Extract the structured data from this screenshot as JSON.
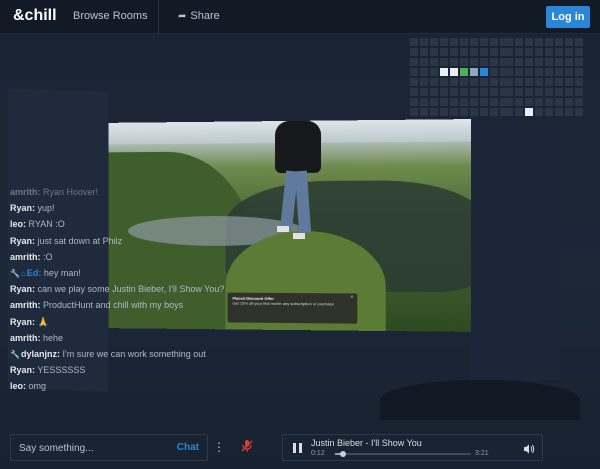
{
  "header": {
    "logo": "&chill",
    "browse_rooms": "Browse Rooms",
    "share": "Share",
    "login": "Log in"
  },
  "led_grid": {
    "grid_a_lit": [
      {
        "row": 3,
        "col": 3,
        "color": "#e8eef3"
      },
      {
        "row": 3,
        "col": 4,
        "color": "#e8eef3"
      },
      {
        "row": 3,
        "col": 5,
        "color": "#4caf50"
      },
      {
        "row": 3,
        "col": 6,
        "color": "#8fa7c2"
      },
      {
        "row": 3,
        "col": 7,
        "color": "#2a86d6"
      }
    ],
    "grid_b_lit": [
      {
        "row": 7,
        "col": 2,
        "color": "#e8eef3"
      }
    ]
  },
  "video": {
    "ad_title": "Placed Discount Offer",
    "ad_text": "Get 15% off your first month any subscription or purchase",
    "ad_close": "×"
  },
  "chat": {
    "messages": [
      {
        "user": "amrith:",
        "text": "Ryan Hoover!",
        "ghost": true
      },
      {
        "user": "Ryan:",
        "text": "yup!"
      },
      {
        "user": "leo:",
        "text": "RYAN :O"
      },
      {
        "user": "Ryan:",
        "text": "just sat down at Philz"
      },
      {
        "user": "amrith:",
        "text": ":O"
      },
      {
        "user": "Ed:",
        "text": "hey man!",
        "mod": true,
        "blue": true
      },
      {
        "user": "Ryan:",
        "text": "can we play some Justin Bieber, I'll Show You?"
      },
      {
        "user": "amrith:",
        "text": "ProductHunt and chill with my boys"
      },
      {
        "user": "Ryan:",
        "text": "🙏"
      },
      {
        "user": "amrith:",
        "text": "hehe"
      },
      {
        "user": "dylanjnz:",
        "text": "I'm sure we can work something out",
        "mod": true
      },
      {
        "user": "Ryan:",
        "text": "YESSSSSS"
      },
      {
        "user": "leo:",
        "text": "omg"
      }
    ],
    "input_placeholder": "Say something...",
    "send_label": "Chat",
    "more_label": "⋮"
  },
  "player": {
    "track": "Justin Bieber - I'll Show You",
    "current_time": "0:12",
    "total_time": "3:21",
    "progress": 0.06
  },
  "colors": {
    "accent": "#2a86d6",
    "mic_muted": "#d9412e"
  }
}
